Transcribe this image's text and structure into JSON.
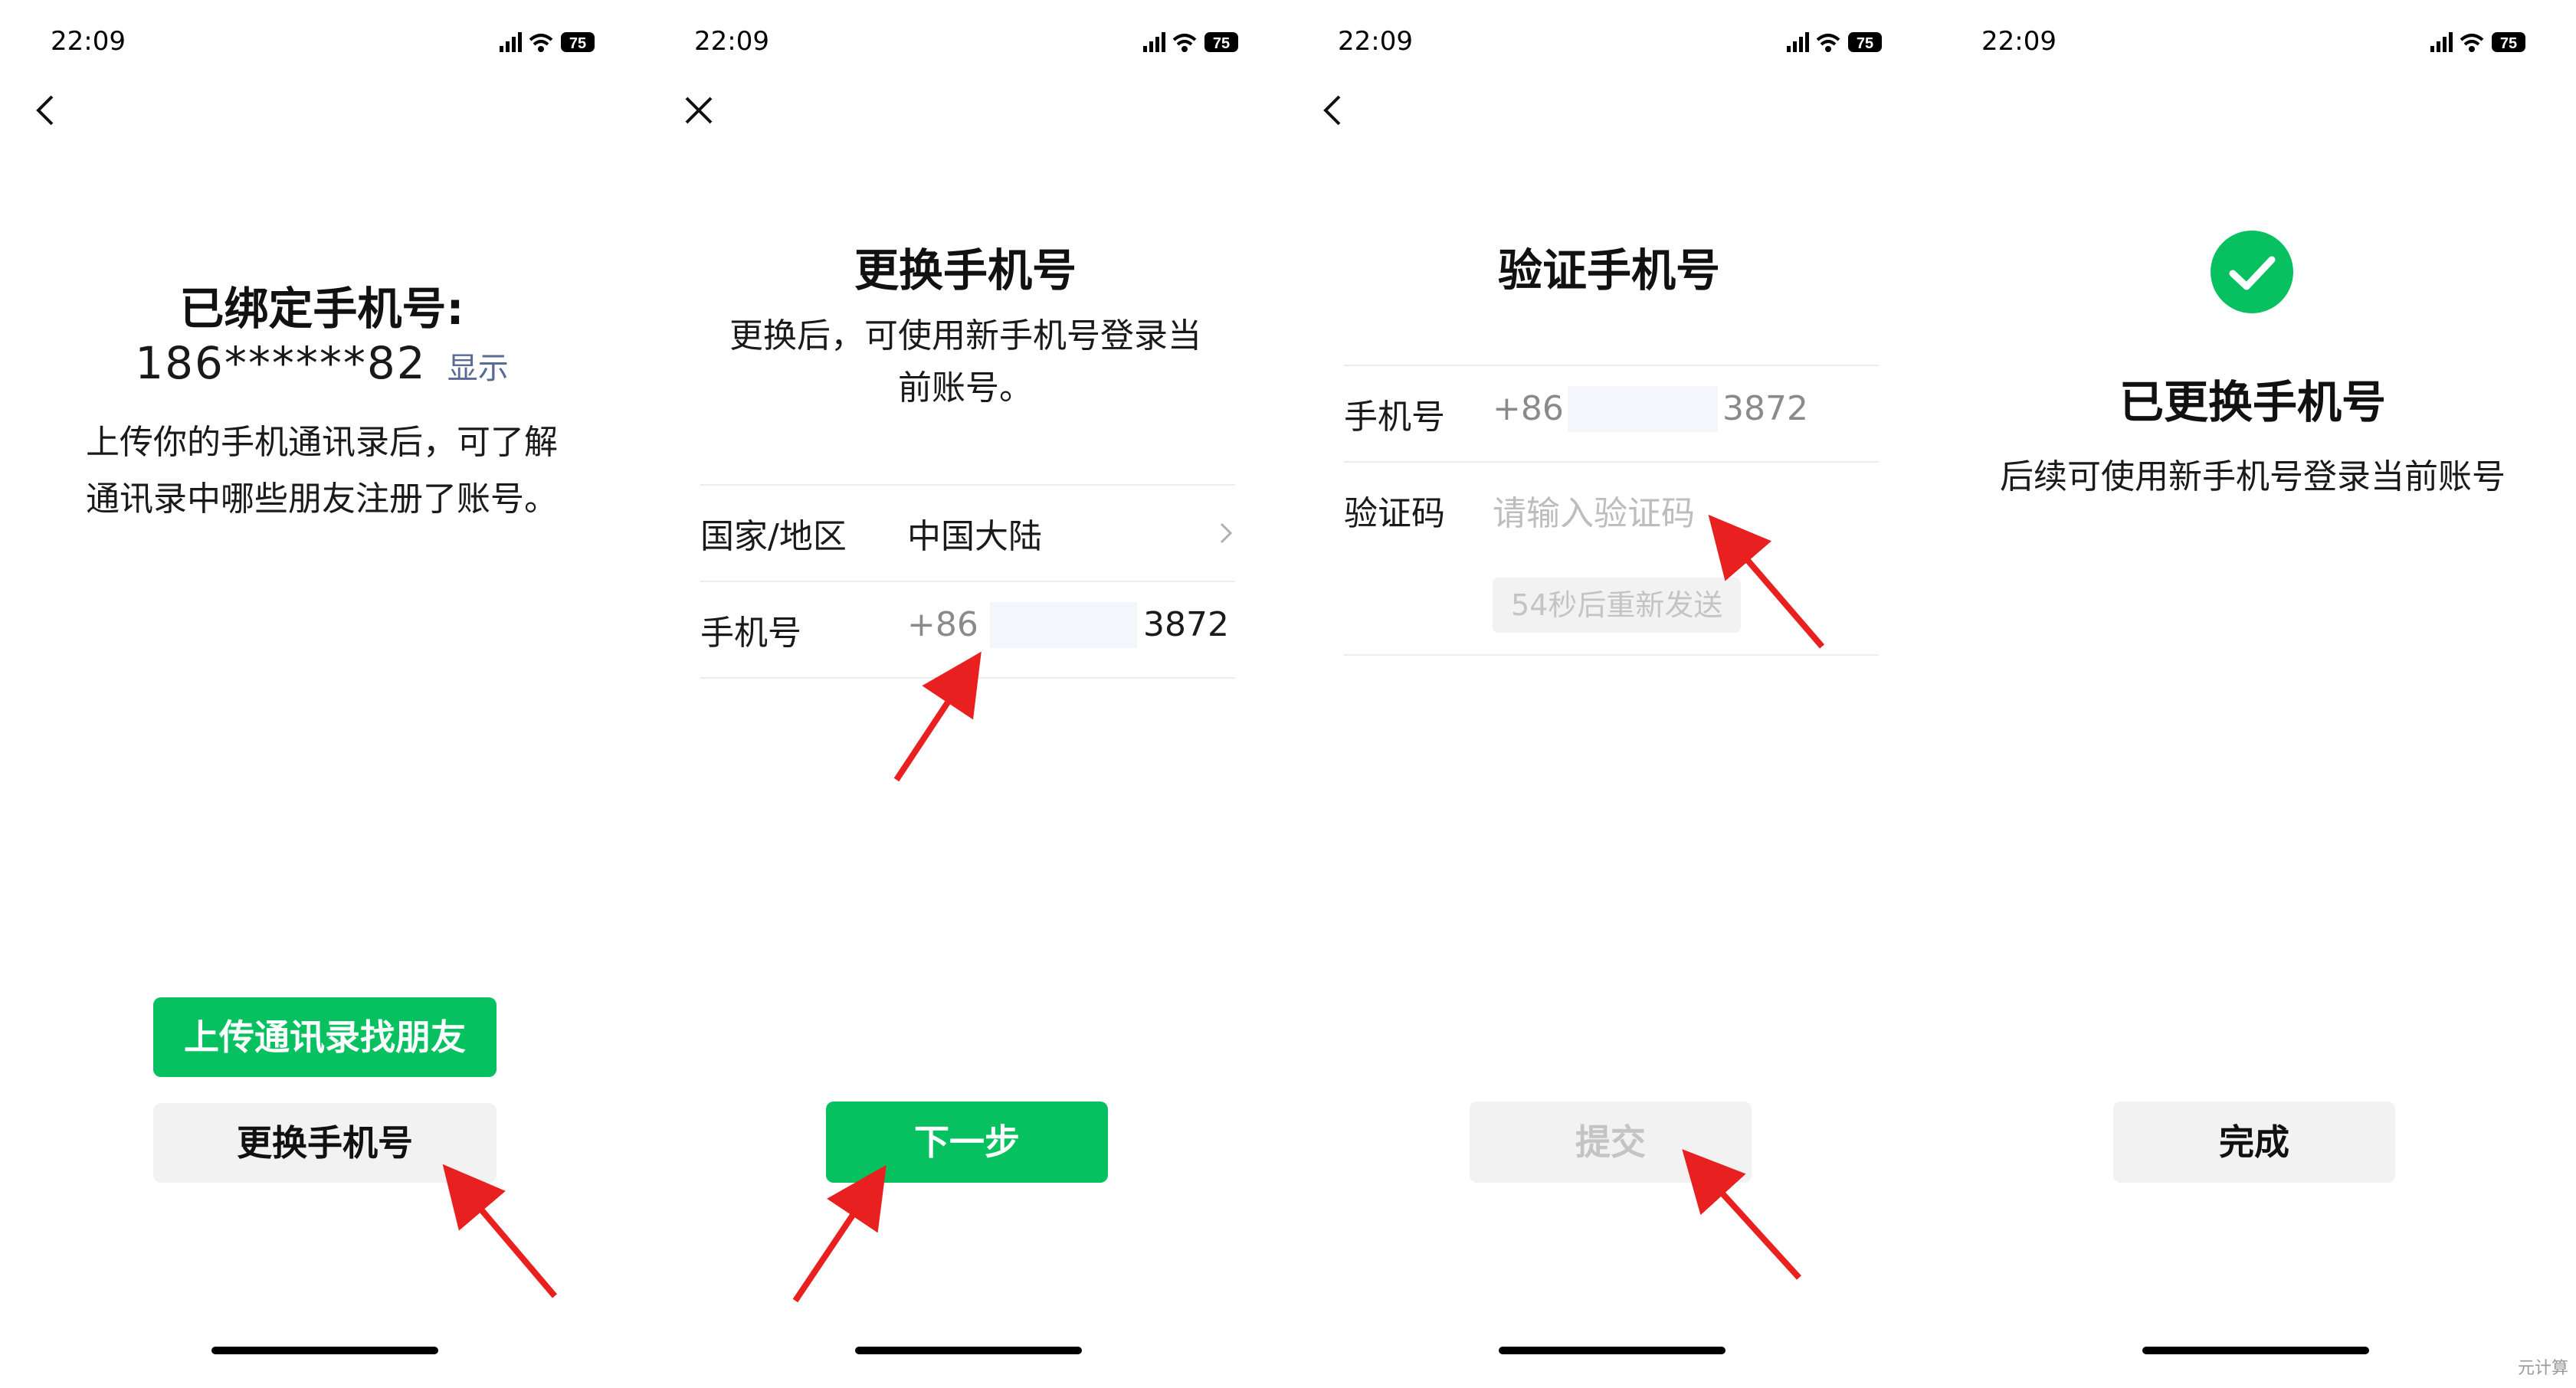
{
  "status_bar": {
    "time": "22:09",
    "battery": "75"
  },
  "screen1": {
    "title": "已绑定手机号:",
    "phone_masked": "186******82",
    "show_link": "显示",
    "description_line1": "上传你的手机通讯录后，可了解",
    "description_line2": "通讯录中哪些朋友注册了账号。",
    "upload_button": "上传通讯录找朋友",
    "change_button": "更换手机号"
  },
  "screen2": {
    "title": "更换手机号",
    "subtitle_line1": "更换后，可使用新手机号登录当",
    "subtitle_line2": "前账号。",
    "region_label": "国家/地区",
    "region_value": "中国大陆",
    "phone_label": "手机号",
    "phone_prefix": "+86",
    "phone_suffix": "3872",
    "next_button": "下一步"
  },
  "screen3": {
    "title": "验证手机号",
    "phone_label": "手机号",
    "phone_prefix": "+86",
    "phone_suffix": "3872",
    "code_label": "验证码",
    "code_placeholder": "请输入验证码",
    "resend_button": "54秒后重新发送",
    "submit_button": "提交"
  },
  "screen4": {
    "title": "已更换手机号",
    "description": "后续可使用新手机号登录当前账号",
    "done_button": "完成"
  },
  "watermark": "元计算",
  "colors": {
    "accent_green": "#07c160",
    "link_blue": "#576b95",
    "arrow_red": "#e8201f"
  }
}
